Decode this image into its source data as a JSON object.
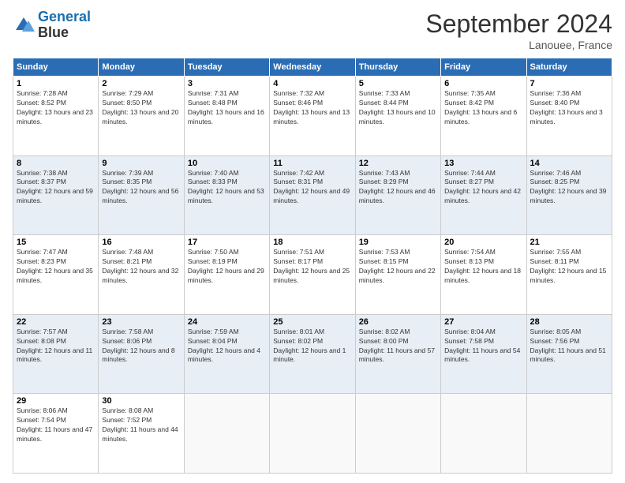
{
  "header": {
    "logo_line1": "General",
    "logo_line2": "Blue",
    "month_title": "September 2024",
    "location": "Lanouee, France"
  },
  "weekdays": [
    "Sunday",
    "Monday",
    "Tuesday",
    "Wednesday",
    "Thursday",
    "Friday",
    "Saturday"
  ],
  "weeks": [
    [
      {
        "day": "1",
        "sunrise": "7:28 AM",
        "sunset": "8:52 PM",
        "daylight": "13 hours and 23 minutes."
      },
      {
        "day": "2",
        "sunrise": "7:29 AM",
        "sunset": "8:50 PM",
        "daylight": "13 hours and 20 minutes."
      },
      {
        "day": "3",
        "sunrise": "7:31 AM",
        "sunset": "8:48 PM",
        "daylight": "13 hours and 16 minutes."
      },
      {
        "day": "4",
        "sunrise": "7:32 AM",
        "sunset": "8:46 PM",
        "daylight": "13 hours and 13 minutes."
      },
      {
        "day": "5",
        "sunrise": "7:33 AM",
        "sunset": "8:44 PM",
        "daylight": "13 hours and 10 minutes."
      },
      {
        "day": "6",
        "sunrise": "7:35 AM",
        "sunset": "8:42 PM",
        "daylight": "13 hours and 6 minutes."
      },
      {
        "day": "7",
        "sunrise": "7:36 AM",
        "sunset": "8:40 PM",
        "daylight": "13 hours and 3 minutes."
      }
    ],
    [
      {
        "day": "8",
        "sunrise": "7:38 AM",
        "sunset": "8:37 PM",
        "daylight": "12 hours and 59 minutes."
      },
      {
        "day": "9",
        "sunrise": "7:39 AM",
        "sunset": "8:35 PM",
        "daylight": "12 hours and 56 minutes."
      },
      {
        "day": "10",
        "sunrise": "7:40 AM",
        "sunset": "8:33 PM",
        "daylight": "12 hours and 53 minutes."
      },
      {
        "day": "11",
        "sunrise": "7:42 AM",
        "sunset": "8:31 PM",
        "daylight": "12 hours and 49 minutes."
      },
      {
        "day": "12",
        "sunrise": "7:43 AM",
        "sunset": "8:29 PM",
        "daylight": "12 hours and 46 minutes."
      },
      {
        "day": "13",
        "sunrise": "7:44 AM",
        "sunset": "8:27 PM",
        "daylight": "12 hours and 42 minutes."
      },
      {
        "day": "14",
        "sunrise": "7:46 AM",
        "sunset": "8:25 PM",
        "daylight": "12 hours and 39 minutes."
      }
    ],
    [
      {
        "day": "15",
        "sunrise": "7:47 AM",
        "sunset": "8:23 PM",
        "daylight": "12 hours and 35 minutes."
      },
      {
        "day": "16",
        "sunrise": "7:48 AM",
        "sunset": "8:21 PM",
        "daylight": "12 hours and 32 minutes."
      },
      {
        "day": "17",
        "sunrise": "7:50 AM",
        "sunset": "8:19 PM",
        "daylight": "12 hours and 29 minutes."
      },
      {
        "day": "18",
        "sunrise": "7:51 AM",
        "sunset": "8:17 PM",
        "daylight": "12 hours and 25 minutes."
      },
      {
        "day": "19",
        "sunrise": "7:53 AM",
        "sunset": "8:15 PM",
        "daylight": "12 hours and 22 minutes."
      },
      {
        "day": "20",
        "sunrise": "7:54 AM",
        "sunset": "8:13 PM",
        "daylight": "12 hours and 18 minutes."
      },
      {
        "day": "21",
        "sunrise": "7:55 AM",
        "sunset": "8:11 PM",
        "daylight": "12 hours and 15 minutes."
      }
    ],
    [
      {
        "day": "22",
        "sunrise": "7:57 AM",
        "sunset": "8:08 PM",
        "daylight": "12 hours and 11 minutes."
      },
      {
        "day": "23",
        "sunrise": "7:58 AM",
        "sunset": "8:06 PM",
        "daylight": "12 hours and 8 minutes."
      },
      {
        "day": "24",
        "sunrise": "7:59 AM",
        "sunset": "8:04 PM",
        "daylight": "12 hours and 4 minutes."
      },
      {
        "day": "25",
        "sunrise": "8:01 AM",
        "sunset": "8:02 PM",
        "daylight": "12 hours and 1 minute."
      },
      {
        "day": "26",
        "sunrise": "8:02 AM",
        "sunset": "8:00 PM",
        "daylight": "11 hours and 57 minutes."
      },
      {
        "day": "27",
        "sunrise": "8:04 AM",
        "sunset": "7:58 PM",
        "daylight": "11 hours and 54 minutes."
      },
      {
        "day": "28",
        "sunrise": "8:05 AM",
        "sunset": "7:56 PM",
        "daylight": "11 hours and 51 minutes."
      }
    ],
    [
      {
        "day": "29",
        "sunrise": "8:06 AM",
        "sunset": "7:54 PM",
        "daylight": "11 hours and 47 minutes."
      },
      {
        "day": "30",
        "sunrise": "8:08 AM",
        "sunset": "7:52 PM",
        "daylight": "11 hours and 44 minutes."
      },
      null,
      null,
      null,
      null,
      null
    ]
  ]
}
